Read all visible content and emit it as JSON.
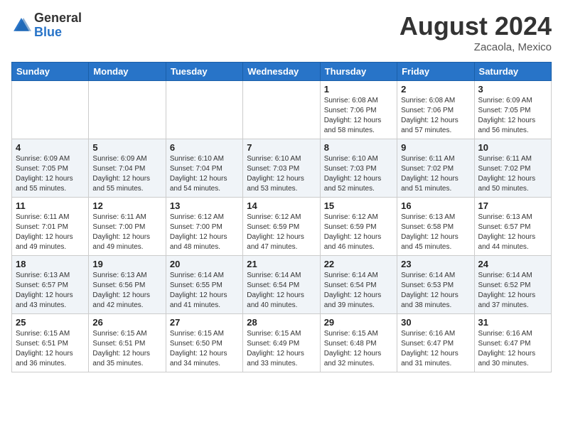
{
  "header": {
    "logo_general": "General",
    "logo_blue": "Blue",
    "month_year": "August 2024",
    "location": "Zacaola, Mexico"
  },
  "weekdays": [
    "Sunday",
    "Monday",
    "Tuesday",
    "Wednesday",
    "Thursday",
    "Friday",
    "Saturday"
  ],
  "weeks": [
    [
      {
        "day": "",
        "info": ""
      },
      {
        "day": "",
        "info": ""
      },
      {
        "day": "",
        "info": ""
      },
      {
        "day": "",
        "info": ""
      },
      {
        "day": "1",
        "info": "Sunrise: 6:08 AM\nSunset: 7:06 PM\nDaylight: 12 hours\nand 58 minutes."
      },
      {
        "day": "2",
        "info": "Sunrise: 6:08 AM\nSunset: 7:06 PM\nDaylight: 12 hours\nand 57 minutes."
      },
      {
        "day": "3",
        "info": "Sunrise: 6:09 AM\nSunset: 7:05 PM\nDaylight: 12 hours\nand 56 minutes."
      }
    ],
    [
      {
        "day": "4",
        "info": "Sunrise: 6:09 AM\nSunset: 7:05 PM\nDaylight: 12 hours\nand 55 minutes."
      },
      {
        "day": "5",
        "info": "Sunrise: 6:09 AM\nSunset: 7:04 PM\nDaylight: 12 hours\nand 55 minutes."
      },
      {
        "day": "6",
        "info": "Sunrise: 6:10 AM\nSunset: 7:04 PM\nDaylight: 12 hours\nand 54 minutes."
      },
      {
        "day": "7",
        "info": "Sunrise: 6:10 AM\nSunset: 7:03 PM\nDaylight: 12 hours\nand 53 minutes."
      },
      {
        "day": "8",
        "info": "Sunrise: 6:10 AM\nSunset: 7:03 PM\nDaylight: 12 hours\nand 52 minutes."
      },
      {
        "day": "9",
        "info": "Sunrise: 6:11 AM\nSunset: 7:02 PM\nDaylight: 12 hours\nand 51 minutes."
      },
      {
        "day": "10",
        "info": "Sunrise: 6:11 AM\nSunset: 7:02 PM\nDaylight: 12 hours\nand 50 minutes."
      }
    ],
    [
      {
        "day": "11",
        "info": "Sunrise: 6:11 AM\nSunset: 7:01 PM\nDaylight: 12 hours\nand 49 minutes."
      },
      {
        "day": "12",
        "info": "Sunrise: 6:11 AM\nSunset: 7:00 PM\nDaylight: 12 hours\nand 49 minutes."
      },
      {
        "day": "13",
        "info": "Sunrise: 6:12 AM\nSunset: 7:00 PM\nDaylight: 12 hours\nand 48 minutes."
      },
      {
        "day": "14",
        "info": "Sunrise: 6:12 AM\nSunset: 6:59 PM\nDaylight: 12 hours\nand 47 minutes."
      },
      {
        "day": "15",
        "info": "Sunrise: 6:12 AM\nSunset: 6:59 PM\nDaylight: 12 hours\nand 46 minutes."
      },
      {
        "day": "16",
        "info": "Sunrise: 6:13 AM\nSunset: 6:58 PM\nDaylight: 12 hours\nand 45 minutes."
      },
      {
        "day": "17",
        "info": "Sunrise: 6:13 AM\nSunset: 6:57 PM\nDaylight: 12 hours\nand 44 minutes."
      }
    ],
    [
      {
        "day": "18",
        "info": "Sunrise: 6:13 AM\nSunset: 6:57 PM\nDaylight: 12 hours\nand 43 minutes."
      },
      {
        "day": "19",
        "info": "Sunrise: 6:13 AM\nSunset: 6:56 PM\nDaylight: 12 hours\nand 42 minutes."
      },
      {
        "day": "20",
        "info": "Sunrise: 6:14 AM\nSunset: 6:55 PM\nDaylight: 12 hours\nand 41 minutes."
      },
      {
        "day": "21",
        "info": "Sunrise: 6:14 AM\nSunset: 6:54 PM\nDaylight: 12 hours\nand 40 minutes."
      },
      {
        "day": "22",
        "info": "Sunrise: 6:14 AM\nSunset: 6:54 PM\nDaylight: 12 hours\nand 39 minutes."
      },
      {
        "day": "23",
        "info": "Sunrise: 6:14 AM\nSunset: 6:53 PM\nDaylight: 12 hours\nand 38 minutes."
      },
      {
        "day": "24",
        "info": "Sunrise: 6:14 AM\nSunset: 6:52 PM\nDaylight: 12 hours\nand 37 minutes."
      }
    ],
    [
      {
        "day": "25",
        "info": "Sunrise: 6:15 AM\nSunset: 6:51 PM\nDaylight: 12 hours\nand 36 minutes."
      },
      {
        "day": "26",
        "info": "Sunrise: 6:15 AM\nSunset: 6:51 PM\nDaylight: 12 hours\nand 35 minutes."
      },
      {
        "day": "27",
        "info": "Sunrise: 6:15 AM\nSunset: 6:50 PM\nDaylight: 12 hours\nand 34 minutes."
      },
      {
        "day": "28",
        "info": "Sunrise: 6:15 AM\nSunset: 6:49 PM\nDaylight: 12 hours\nand 33 minutes."
      },
      {
        "day": "29",
        "info": "Sunrise: 6:15 AM\nSunset: 6:48 PM\nDaylight: 12 hours\nand 32 minutes."
      },
      {
        "day": "30",
        "info": "Sunrise: 6:16 AM\nSunset: 6:47 PM\nDaylight: 12 hours\nand 31 minutes."
      },
      {
        "day": "31",
        "info": "Sunrise: 6:16 AM\nSunset: 6:47 PM\nDaylight: 12 hours\nand 30 minutes."
      }
    ]
  ]
}
